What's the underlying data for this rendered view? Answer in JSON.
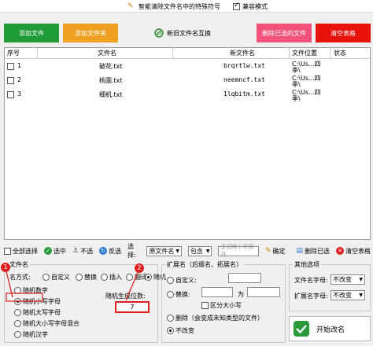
{
  "app": {
    "title": "智能清除文件名中的特殊符号",
    "compat_mode_label": "兼容模式"
  },
  "top_buttons": {
    "add_file": "添加文件",
    "add_folder": "添加文件夹",
    "swap_names": "新旧文件名互换",
    "delete_selected": "删除已选的文件",
    "clear_list": "清空表格"
  },
  "table": {
    "columns": [
      "序号",
      "文件名",
      "新文件名",
      "文件位置",
      "状态"
    ],
    "rows": [
      {
        "index": "1",
        "name": "破花.txt",
        "new_name": "brqrtlw.txt",
        "path": "C:\\Us...四季\\",
        "status": ""
      },
      {
        "index": "2",
        "name": "桃園.txt",
        "new_name": "neemncf.txt",
        "path": "C:\\Us...四季\\",
        "status": ""
      },
      {
        "index": "3",
        "name": "细机.txt",
        "new_name": "1lqbitm.txt",
        "path": "C:\\Us...四季\\",
        "status": ""
      }
    ]
  },
  "toolbar": {
    "select_all": "全部选择",
    "select": "选中",
    "deselect": "不选",
    "invert": "反选",
    "select_label": "选择:",
    "field_value": "原文件名",
    "match_value": "包含",
    "keyword_placeholder": "多词用 | 号隔开",
    "confirm": "确定",
    "delete_selected": "删除已选",
    "clear_table": "清空表格"
  },
  "filename_group": {
    "legend": "文件名",
    "name_mode_label": "名方式:",
    "modes": [
      "自定义",
      "替换",
      "插入",
      "翻译",
      "随机"
    ],
    "selected_mode": "随机",
    "random_types": [
      "随机数字",
      "随机小写字母",
      "随机大写字母",
      "随机大小写字母混合",
      "随机汉字"
    ],
    "selected_random_type": "随机小写字母",
    "length_label": "随机生成位数:",
    "length_value": "7",
    "markers": [
      "1",
      "2"
    ]
  },
  "extension_group": {
    "legend": "扩展名（后缀名、拓展名）",
    "custom_label": "自定义:",
    "replace_label": "替换:",
    "replace_with": "为",
    "case_sensitive": "区分大小写",
    "delete_label": "删除（会变成未知类型的文件）",
    "unchanged_label": "不改变",
    "selected": "不改变"
  },
  "other_group": {
    "legend": "其他选项",
    "filename_case_label": "文件名字母:",
    "filename_case_value": "不改变",
    "ext_case_label": "扩展名字母:",
    "ext_case_value": "不改变"
  },
  "start_button": "开始改名",
  "colors": {
    "add_file": "#1f9b37",
    "add_folder": "#f0a020",
    "delete_selected": "#f2527a",
    "clear_list": "#e8120c",
    "marker": "#e02020"
  }
}
